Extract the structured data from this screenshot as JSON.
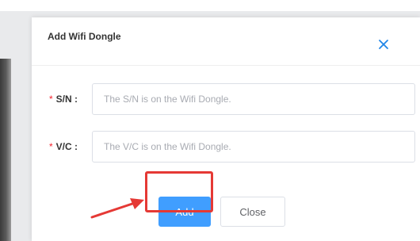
{
  "dialog": {
    "title": "Add Wifi Dongle",
    "close_icon": "close-icon",
    "fields": [
      {
        "required_mark": "*",
        "label": "S/N :",
        "value": "",
        "placeholder": "The S/N is on the Wifi Dongle."
      },
      {
        "required_mark": "*",
        "label": "V/C :",
        "value": "",
        "placeholder": "The V/C is on the Wifi Dongle."
      }
    ],
    "buttons": {
      "add_label": "Add",
      "close_label": "Close"
    }
  },
  "annotation": {
    "highlight_target": "add-button",
    "arrow_icon": "arrow-annotation-icon"
  },
  "colors": {
    "primary": "#409eff",
    "required": "#f5222d",
    "annotation": "#e53935",
    "close_icon": "#1f86e8"
  }
}
